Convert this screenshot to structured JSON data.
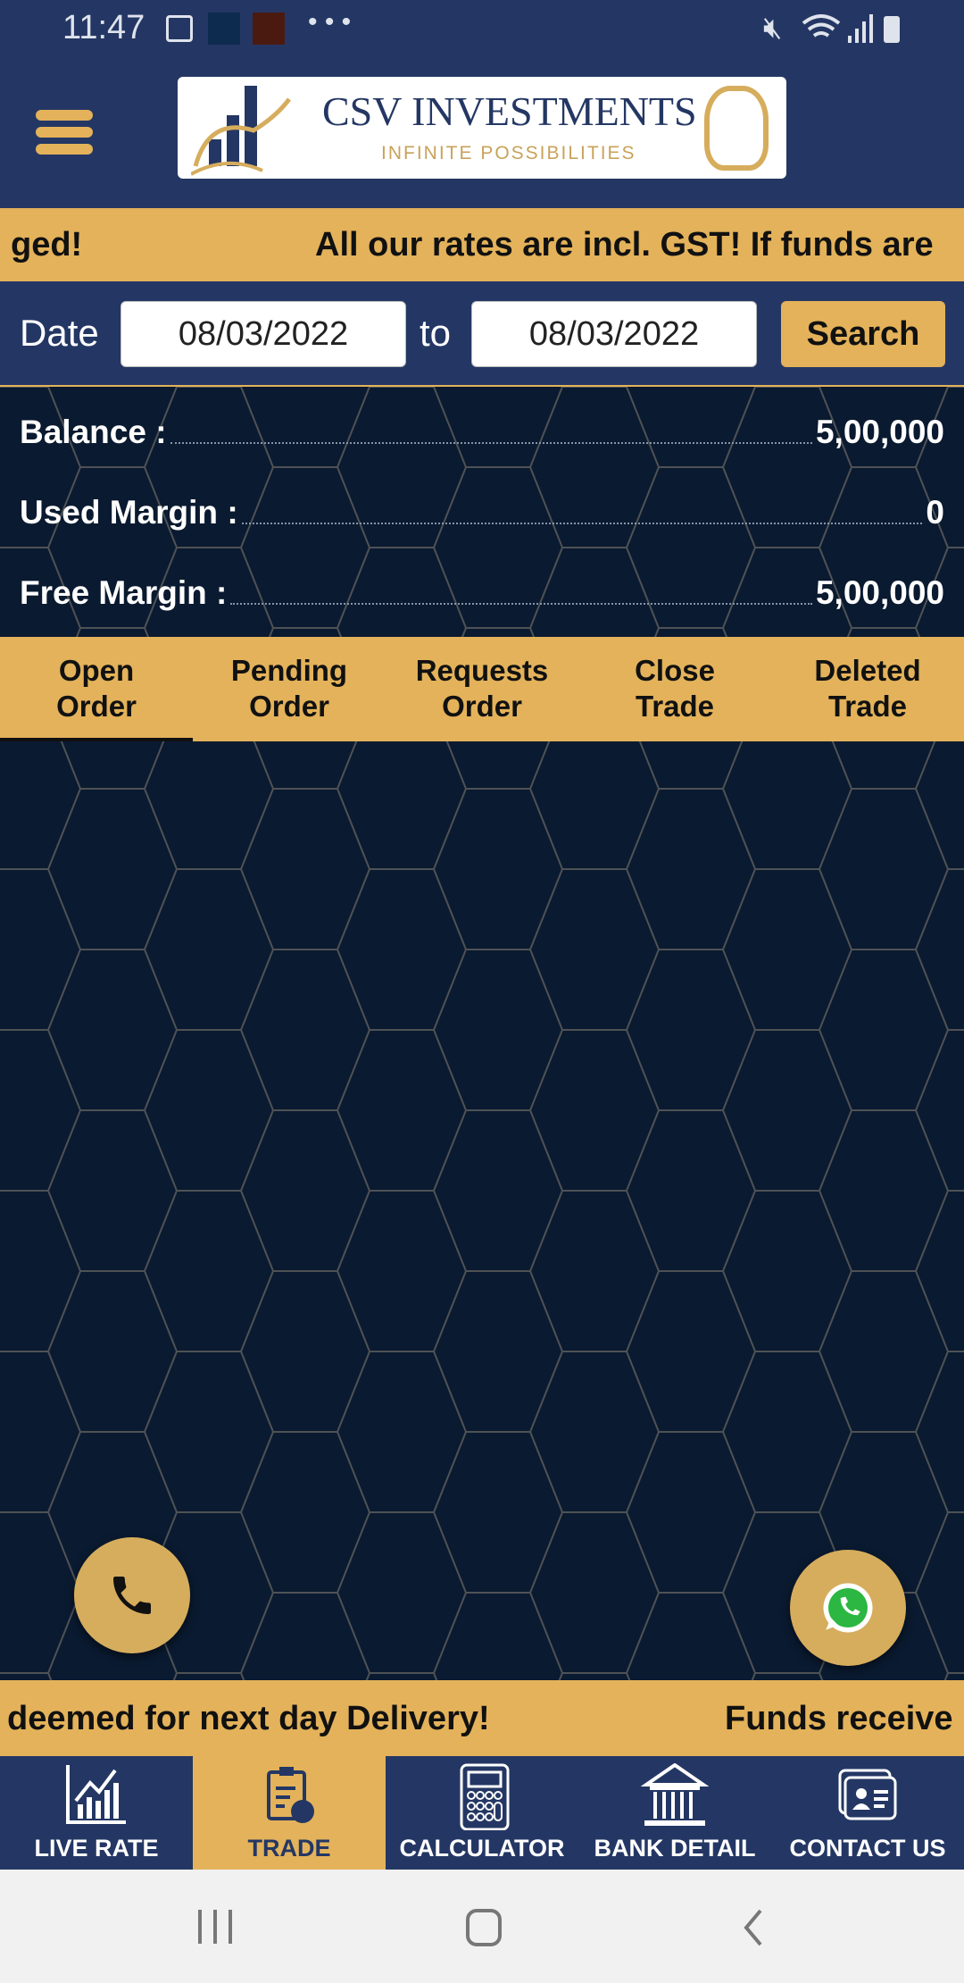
{
  "status_bar": {
    "time": "11:47",
    "more": "• • •"
  },
  "header": {
    "logo_title": "CSV INVESTMENTS",
    "logo_subtitle": "INFINITE POSSIBILITIES"
  },
  "ticker_top": {
    "text_left": "ged!",
    "text_right": "All our rates are incl. GST! If funds are"
  },
  "date_filter": {
    "label": "Date",
    "from": "08/03/2022",
    "to_label": "to",
    "to": "08/03/2022",
    "search_label": "Search"
  },
  "balance": {
    "rows": [
      {
        "label": "Balance :",
        "value": "5,00,000"
      },
      {
        "label": "Used Margin :",
        "value": "0"
      },
      {
        "label": "Free Margin :",
        "value": "5,00,000"
      }
    ]
  },
  "tabs": [
    {
      "line1": "Open",
      "line2": "Order",
      "active": true
    },
    {
      "line1": "Pending",
      "line2": "Order"
    },
    {
      "line1": "Requests",
      "line2": "Order"
    },
    {
      "line1": "Close",
      "line2": "Trade"
    },
    {
      "line1": "Deleted",
      "line2": "Trade"
    }
  ],
  "ticker_bottom": {
    "text_left": "deemed for next day Delivery!",
    "text_right": "Funds receive"
  },
  "bottom_nav": [
    {
      "label": "LIVE RATE",
      "icon": "chart-icon"
    },
    {
      "label": "TRADE",
      "icon": "clipboard-icon",
      "active": true
    },
    {
      "label": "CALCULATOR",
      "icon": "calculator-icon"
    },
    {
      "label": "BANK DETAIL",
      "icon": "bank-icon"
    },
    {
      "label": "CONTACT US",
      "icon": "contact-card-icon"
    }
  ],
  "colors": {
    "navy": "#243764",
    "gold": "#e3b25a",
    "content_bg": "#0a1a30"
  }
}
